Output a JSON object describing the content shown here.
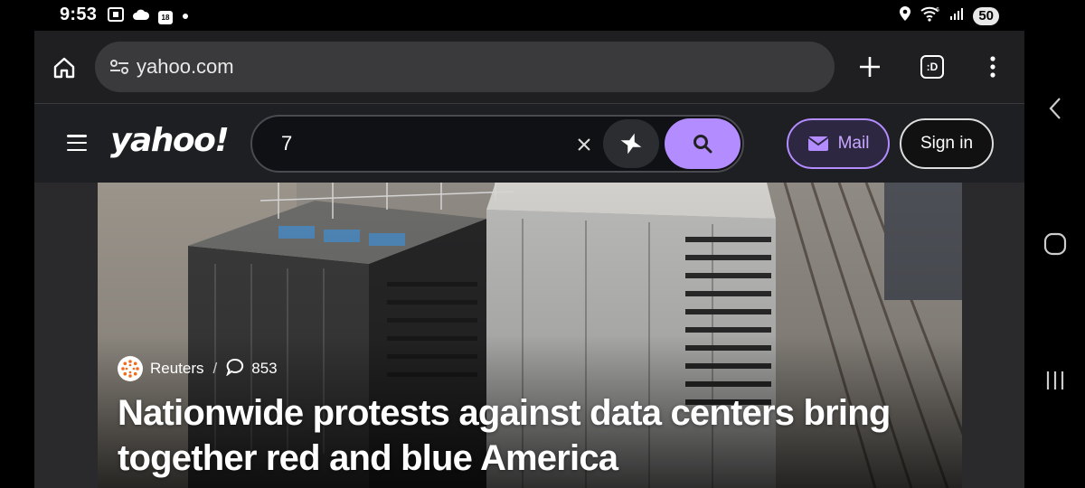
{
  "status_bar": {
    "time": "9:53",
    "calendar_date": "18",
    "battery": "50",
    "icons_left": [
      "screenshot-icon",
      "cloud-icon",
      "calendar-icon",
      "dot-icon"
    ],
    "icons_right": [
      "location-icon",
      "wifi-icon",
      "signal-icon",
      "battery-icon"
    ]
  },
  "browser": {
    "url": "yahoo.com",
    "new_tab_icon": "plus-icon",
    "tabs_label": ":D",
    "menu_icon": "more-vert-icon"
  },
  "yahoo_header": {
    "logo": "yahoo!",
    "search_value": "7",
    "mail_label": "Mail",
    "signin_label": "Sign in",
    "accent_color": "#b38cff"
  },
  "article": {
    "source": "Reuters",
    "comment_count": "853",
    "headline": "Nationwide protests against data centers bring together red and blue America"
  },
  "nav_bar": {
    "icons": [
      "back-icon",
      "home-icon",
      "recents-icon"
    ]
  }
}
